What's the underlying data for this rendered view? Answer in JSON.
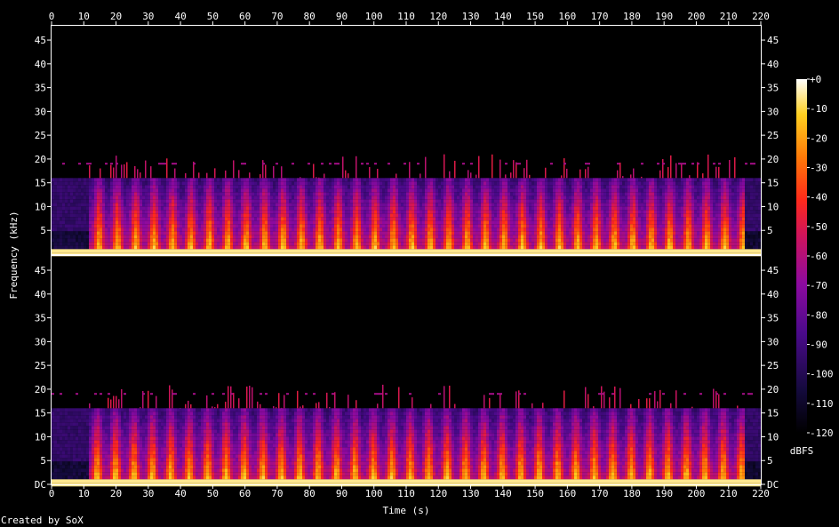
{
  "chart_data": {
    "type": "heatmap",
    "xlabel": "Time (s)",
    "ylabel": "Frequency (kHz)",
    "xlim": [
      0,
      220
    ],
    "ylim": [
      0,
      48
    ],
    "x_ticks": [
      "0",
      "10",
      "20",
      "30",
      "40",
      "50",
      "60",
      "70",
      "80",
      "90",
      "100",
      "110",
      "120",
      "130",
      "140",
      "150",
      "160",
      "170",
      "180",
      "190",
      "200",
      "210",
      "220"
    ],
    "y_ticks_top": [
      "5",
      "10",
      "15",
      "20",
      "25",
      "30",
      "35",
      "40",
      "45"
    ],
    "y_ticks_bottom": [
      "DC",
      "5",
      "10",
      "15",
      "20",
      "25",
      "30",
      "35",
      "40",
      "45"
    ],
    "colorbar": {
      "label": "dBFS",
      "ticks": [
        "+0",
        "-10",
        "-20",
        "-30",
        "-40",
        "-50",
        "-60",
        "-70",
        "-80",
        "-90",
        "-100",
        "-110",
        "-120"
      ],
      "range": [
        -120,
        0
      ]
    },
    "channels": 2,
    "bandwidth_cutoff_khz": 16,
    "sparse_content_max_khz": 21,
    "colors": {
      "background": "#000000",
      "axis": "#ffffff",
      "peak": "#ffffe0",
      "mid": "#ff2a1a",
      "low": "#8a0fa0",
      "floor": "#1c0a40"
    }
  },
  "footer": {
    "credit": "Created by SoX"
  }
}
